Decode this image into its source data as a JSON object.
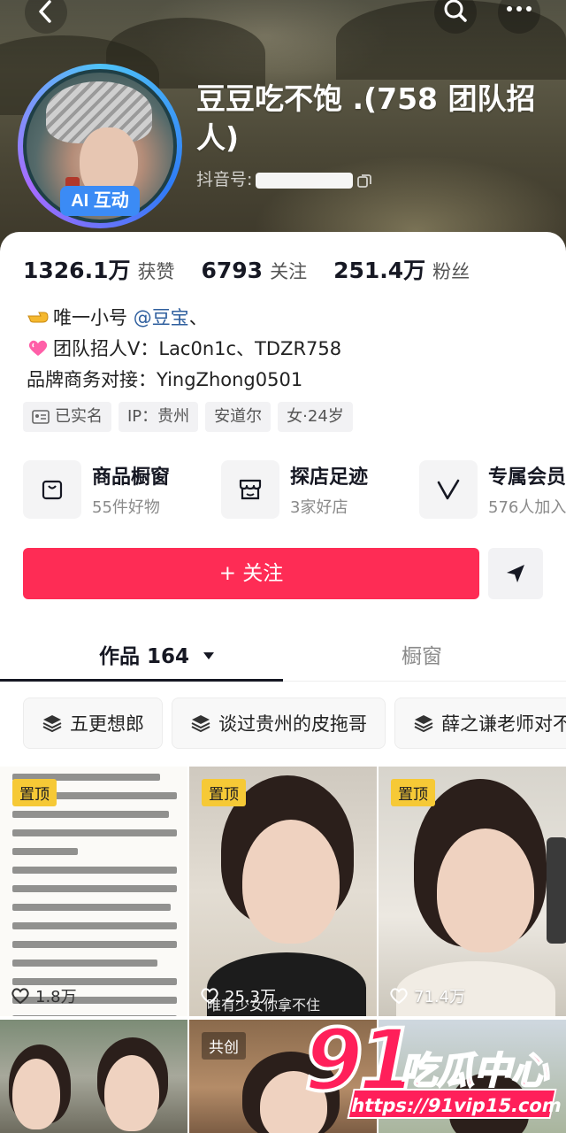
{
  "profile": {
    "name": "豆豆吃不饱 .(758 团队招人)",
    "douyin_id_label": "抖音号:",
    "ai_badge": "AI 互动"
  },
  "stats": [
    {
      "value": "1326.1万",
      "label": "获赞"
    },
    {
      "value": "6793",
      "label": "关注"
    },
    {
      "value": "251.4万",
      "label": "粉丝"
    }
  ],
  "bio": {
    "line1_prefix": "唯一小号",
    "line1_mention": "@豆宝",
    "line1_suffix": "、",
    "line2": "团队招人V：Lac0n1c、TDZR758",
    "line3": "品牌商务对接：YingZhong0501"
  },
  "tags": [
    "已实名",
    "IP：贵州",
    "安道尔",
    "女·24岁"
  ],
  "shortcuts": [
    {
      "title": "商品橱窗",
      "subtitle": "55件好物",
      "icon": "bag-icon"
    },
    {
      "title": "探店足迹",
      "subtitle": "3家好店",
      "icon": "shop-icon"
    },
    {
      "title": "专属会员",
      "subtitle": "576人加入",
      "icon": "vip-icon"
    }
  ],
  "actions": {
    "follow_label": "+ 关注"
  },
  "tabs": {
    "works_label": "作品 164",
    "shop_label": "橱窗"
  },
  "collections": [
    "五更想郎",
    "谈过贵州的皮拖哥",
    "薛之谦老师对不"
  ],
  "videos": [
    {
      "badge": "置顶",
      "likes": "1.8万"
    },
    {
      "badge": "置顶",
      "likes": "25.3万",
      "caption": "唯有少女你拿不住"
    },
    {
      "badge": "置顶",
      "likes": "71.4万"
    },
    {
      "badge": ""
    },
    {
      "badge": "共创"
    },
    {
      "badge": ""
    }
  ],
  "watermark": {
    "number": "91",
    "text": "吃瓜中心",
    "url": "https://91vip15.com"
  },
  "colors": {
    "follow_button": "#fe2c55",
    "pin_badge": "#f6c936",
    "mention": "#2f5f9e",
    "watermark": "#ff1f5a"
  }
}
